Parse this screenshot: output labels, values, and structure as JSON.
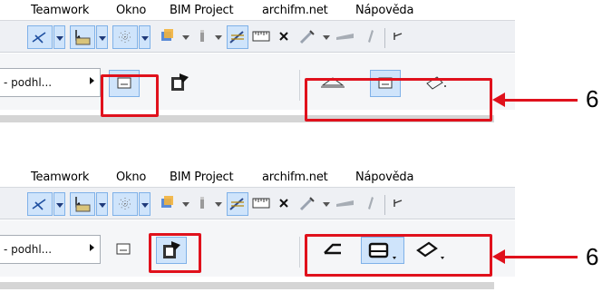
{
  "menu": {
    "items": [
      "Teamwork",
      "Okno",
      "BIM Project",
      "archifm.net",
      "Nápověda"
    ]
  },
  "top_panel": {
    "dropdown_label": "- podhl...",
    "callout_number": "6"
  },
  "bottom_panel": {
    "dropdown_label": "- podhl...",
    "callout_number": "6"
  },
  "colors": {
    "highlight": "#e0111c",
    "selected_bg": "#cfe4fb",
    "selected_border": "#7fb1e8"
  },
  "icons": {
    "toolbar": [
      "pencil-cross-icon",
      "selection-arrow-icon",
      "snowflake-grid-icon",
      "layers-icon",
      "marker-icon",
      "magic-wand-icon",
      "ruler-icon",
      "cross-icon",
      "eyedropper-icon",
      "line-icon",
      "pen-icon"
    ],
    "infobar_top": [
      "view-plan-icon",
      "paste-special-icon",
      "triangle-plane-icon",
      "rectangle-plane-icon",
      "rotated-plane-icon"
    ],
    "infobar_bottom": [
      "view-plan-icon",
      "paste-special-icon",
      "slanted-plane-icon",
      "rectangle-plane-icon",
      "tilted-plane-icon"
    ]
  }
}
